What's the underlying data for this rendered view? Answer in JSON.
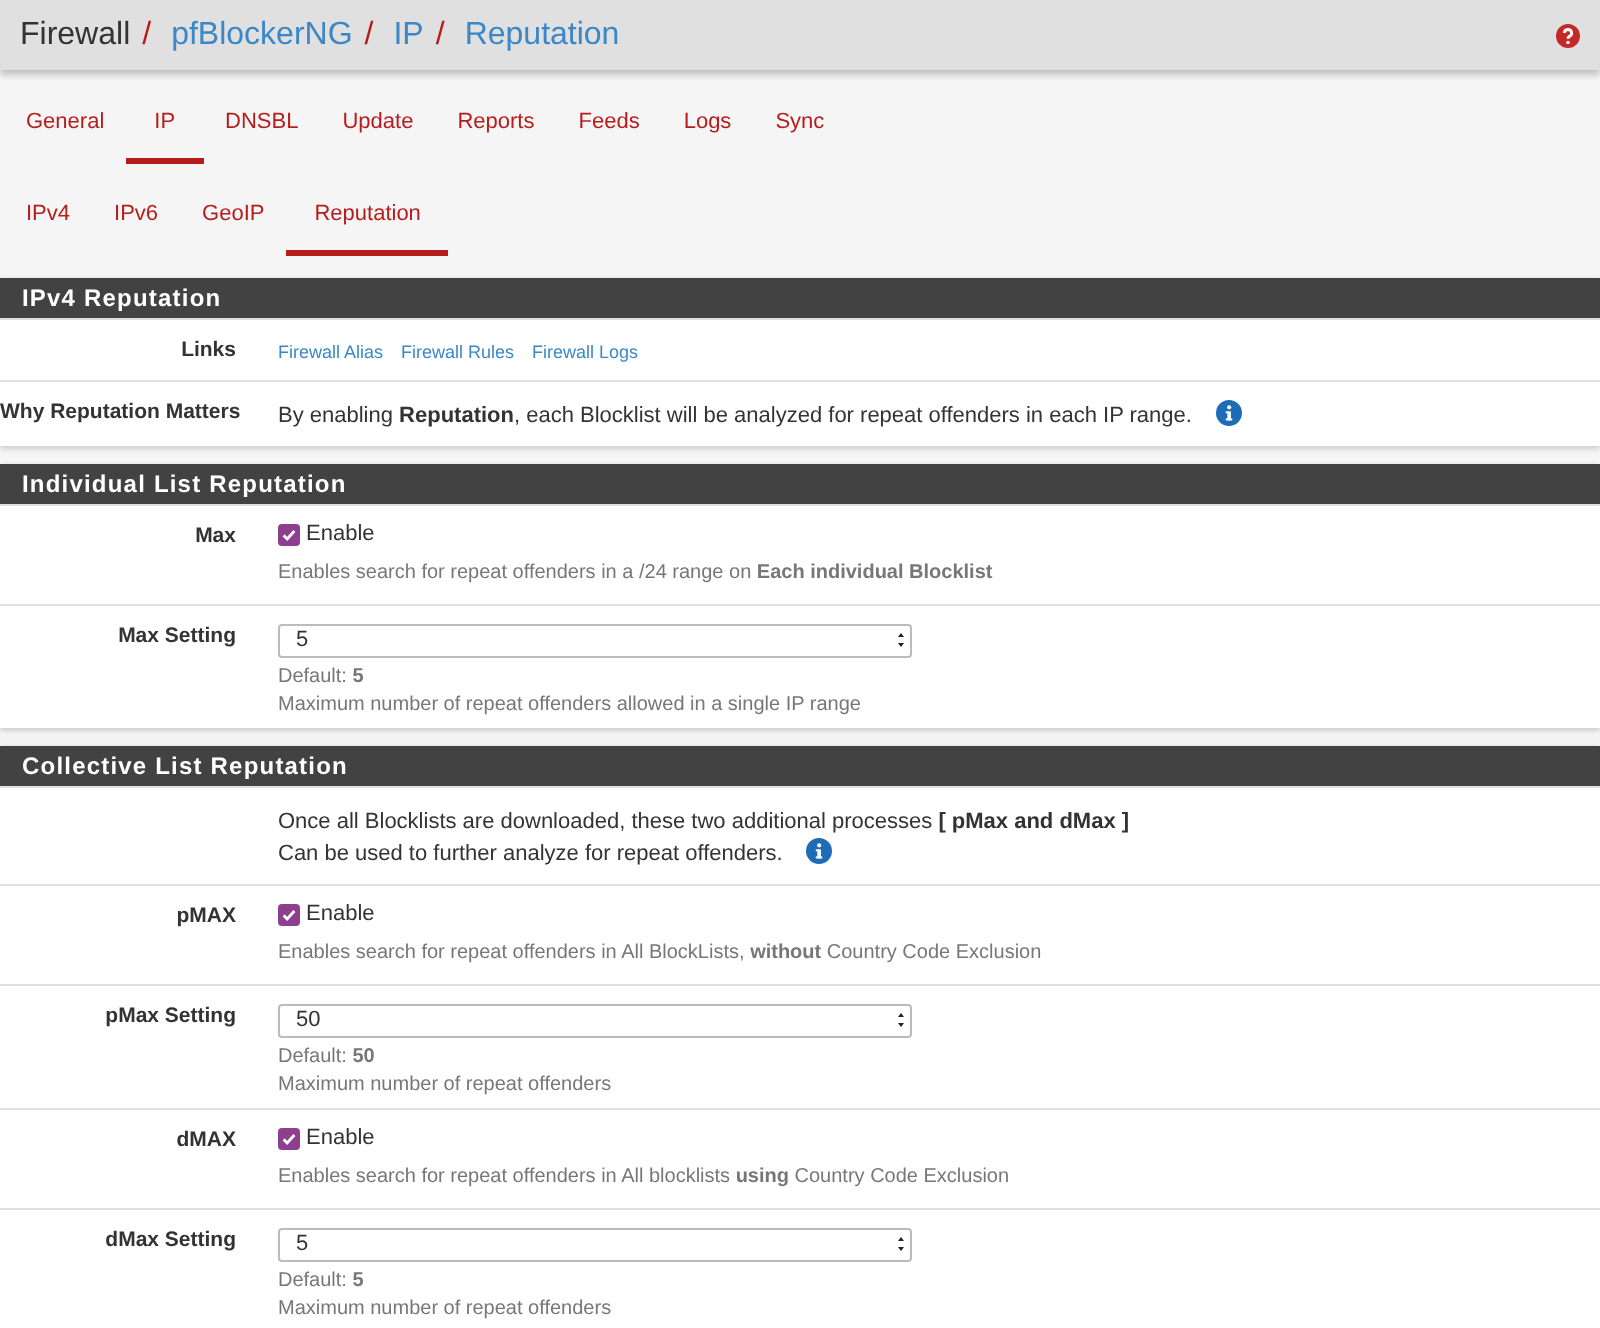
{
  "breadcrumb": [
    {
      "text": "Firewall",
      "link": false
    },
    {
      "text": "pfBlockerNG",
      "link": true
    },
    {
      "text": "IP",
      "link": true
    },
    {
      "text": "Reputation",
      "link": true
    }
  ],
  "breadcrumb_separators": [
    "/",
    "/",
    "/"
  ],
  "tabs": [
    {
      "label": "General",
      "selected": false
    },
    {
      "label": "IP",
      "selected": true
    },
    {
      "label": "DNSBL",
      "selected": false
    },
    {
      "label": "Update",
      "selected": false
    },
    {
      "label": "Reports",
      "selected": false
    },
    {
      "label": "Feeds",
      "selected": false
    },
    {
      "label": "Logs",
      "selected": false
    },
    {
      "label": "Sync",
      "selected": false
    }
  ],
  "subtabs": [
    {
      "label": "IPv4",
      "selected": false
    },
    {
      "label": "IPv6",
      "selected": false
    },
    {
      "label": "GeoIP",
      "selected": false
    },
    {
      "label": "Reputation",
      "selected": true
    }
  ],
  "panels": [
    {
      "title": "IPv4 Reputation",
      "rows": [
        {
          "kind": "links",
          "label": "Links",
          "links": [
            "Firewall Alias",
            "Firewall Rules",
            "Firewall Logs"
          ]
        },
        {
          "kind": "text",
          "label": "Why Reputation Matters",
          "lines": [
            "By enabling **Reputation**, each Blocklist will be analyzed for repeat offenders in each IP range."
          ],
          "info": true
        }
      ]
    },
    {
      "title": "Individual List Reputation",
      "rows": [
        {
          "kind": "checkbox",
          "label": "Max",
          "option": "Enable",
          "checked": true,
          "help": "Enables search for repeat offenders in a /24 range on **Each individual Blocklist**"
        },
        {
          "kind": "select",
          "label": "Max Setting",
          "value": "5",
          "help_lines": [
            "Default: **5**",
            "Maximum number of repeat offenders allowed in a single IP range"
          ]
        }
      ]
    },
    {
      "title": "Collective List Reputation",
      "rows": [
        {
          "kind": "text",
          "lines": [
            "Once all Blocklists are downloaded, these two additional processes **[ pMax and dMax ]**",
            "Can be used to further analyze for repeat offenders."
          ],
          "info": true
        },
        {
          "kind": "checkbox",
          "label": "pMAX",
          "option": "Enable",
          "checked": true,
          "help": "Enables search for repeat offenders in All BlockLists, **without** Country Code Exclusion"
        },
        {
          "kind": "select",
          "label": "pMax Setting",
          "value": "50",
          "help_lines": [
            "Default: **50**",
            "Maximum number of repeat offenders"
          ]
        },
        {
          "kind": "checkbox",
          "label": "dMAX",
          "option": "Enable",
          "checked": true,
          "help": "Enables search for repeat offenders in All blocklists **using** Country Code Exclusion"
        },
        {
          "kind": "select",
          "label": "dMax Setting",
          "value": "5",
          "help_lines": [
            "Default: **5**",
            "Maximum number of repeat offenders"
          ]
        }
      ]
    }
  ]
}
